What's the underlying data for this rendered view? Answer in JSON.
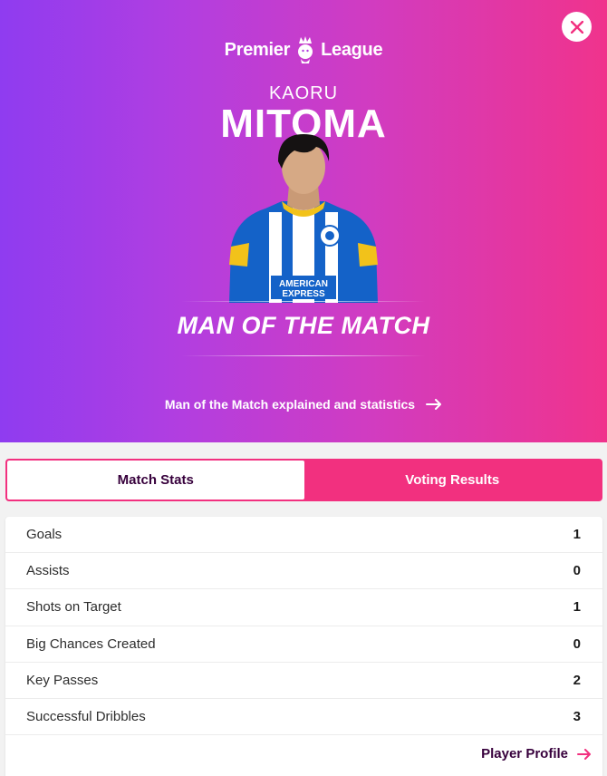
{
  "header": {
    "logo_text_left": "Premier",
    "logo_text_right": "League",
    "first_name": "KAORU",
    "last_name": "MITOMA",
    "award": "MAN OF THE MATCH",
    "explained_link": "Man of the Match explained and statistics",
    "sponsor_text_line1": "AMERICAN",
    "sponsor_text_line2": "EXPRESS"
  },
  "tabs": [
    {
      "label": "Match Stats",
      "active": true
    },
    {
      "label": "Voting Results",
      "active": false
    }
  ],
  "stats": [
    {
      "label": "Goals",
      "value": "1"
    },
    {
      "label": "Assists",
      "value": "0"
    },
    {
      "label": "Shots on Target",
      "value": "1"
    },
    {
      "label": "Big Chances Created",
      "value": "0"
    },
    {
      "label": "Key Passes",
      "value": "2"
    },
    {
      "label": "Successful Dribbles",
      "value": "3"
    }
  ],
  "footer": {
    "player_profile_label": "Player Profile"
  },
  "colors": {
    "accent": "#f2307f",
    "dark": "#37003c",
    "purple": "#8f3cf0"
  },
  "icons": [
    "close-icon",
    "lion-crown-icon",
    "arrow-right-icon"
  ]
}
